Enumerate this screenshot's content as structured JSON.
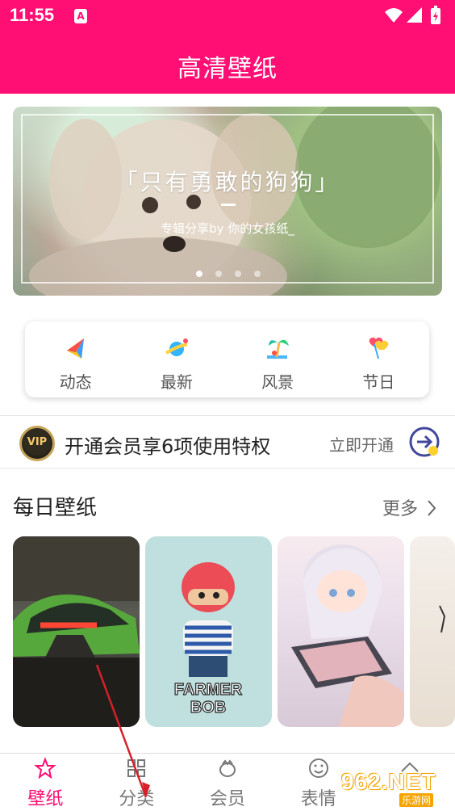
{
  "status_bar": {
    "time": "11:55",
    "notification_badge": "A"
  },
  "app_bar": {
    "title": "高清壁纸"
  },
  "banner": {
    "title": "「只有勇敢的狗狗」",
    "subtitle": "专辑分享by 你的女孩纸_",
    "pages": 4,
    "active_page": 1
  },
  "quick_nav": [
    {
      "label": "动态",
      "icon": "sail-icon"
    },
    {
      "label": "最新",
      "icon": "planet-icon"
    },
    {
      "label": "风景",
      "icon": "palm-tree-icon"
    },
    {
      "label": "节日",
      "icon": "balloon-heart-icon"
    }
  ],
  "vip_strip": {
    "badge_text": "VIP",
    "text": "开通会员享6项使用特权",
    "action": "立即开通"
  },
  "daily_section": {
    "title": "每日壁纸",
    "more": "更多",
    "cards": [
      {
        "caption": ""
      },
      {
        "caption": "FARMER BOB"
      },
      {
        "caption": ""
      },
      {
        "caption": ""
      }
    ]
  },
  "bottom_nav": [
    {
      "label": "壁纸",
      "icon": "star-icon",
      "active": true
    },
    {
      "label": "分类",
      "icon": "grid-icon",
      "active": false
    },
    {
      "label": "会员",
      "icon": "crown-icon",
      "active": false
    },
    {
      "label": "表情",
      "icon": "smile-icon",
      "active": false
    },
    {
      "label": "",
      "icon": "chevron-up-icon",
      "active": false
    }
  ],
  "watermark": {
    "main": "962.NET",
    "sub": "乐游网"
  },
  "colors": {
    "brand": "#ff0e73",
    "vip_gold": "#c5a458",
    "arrow": "#d5212b"
  }
}
